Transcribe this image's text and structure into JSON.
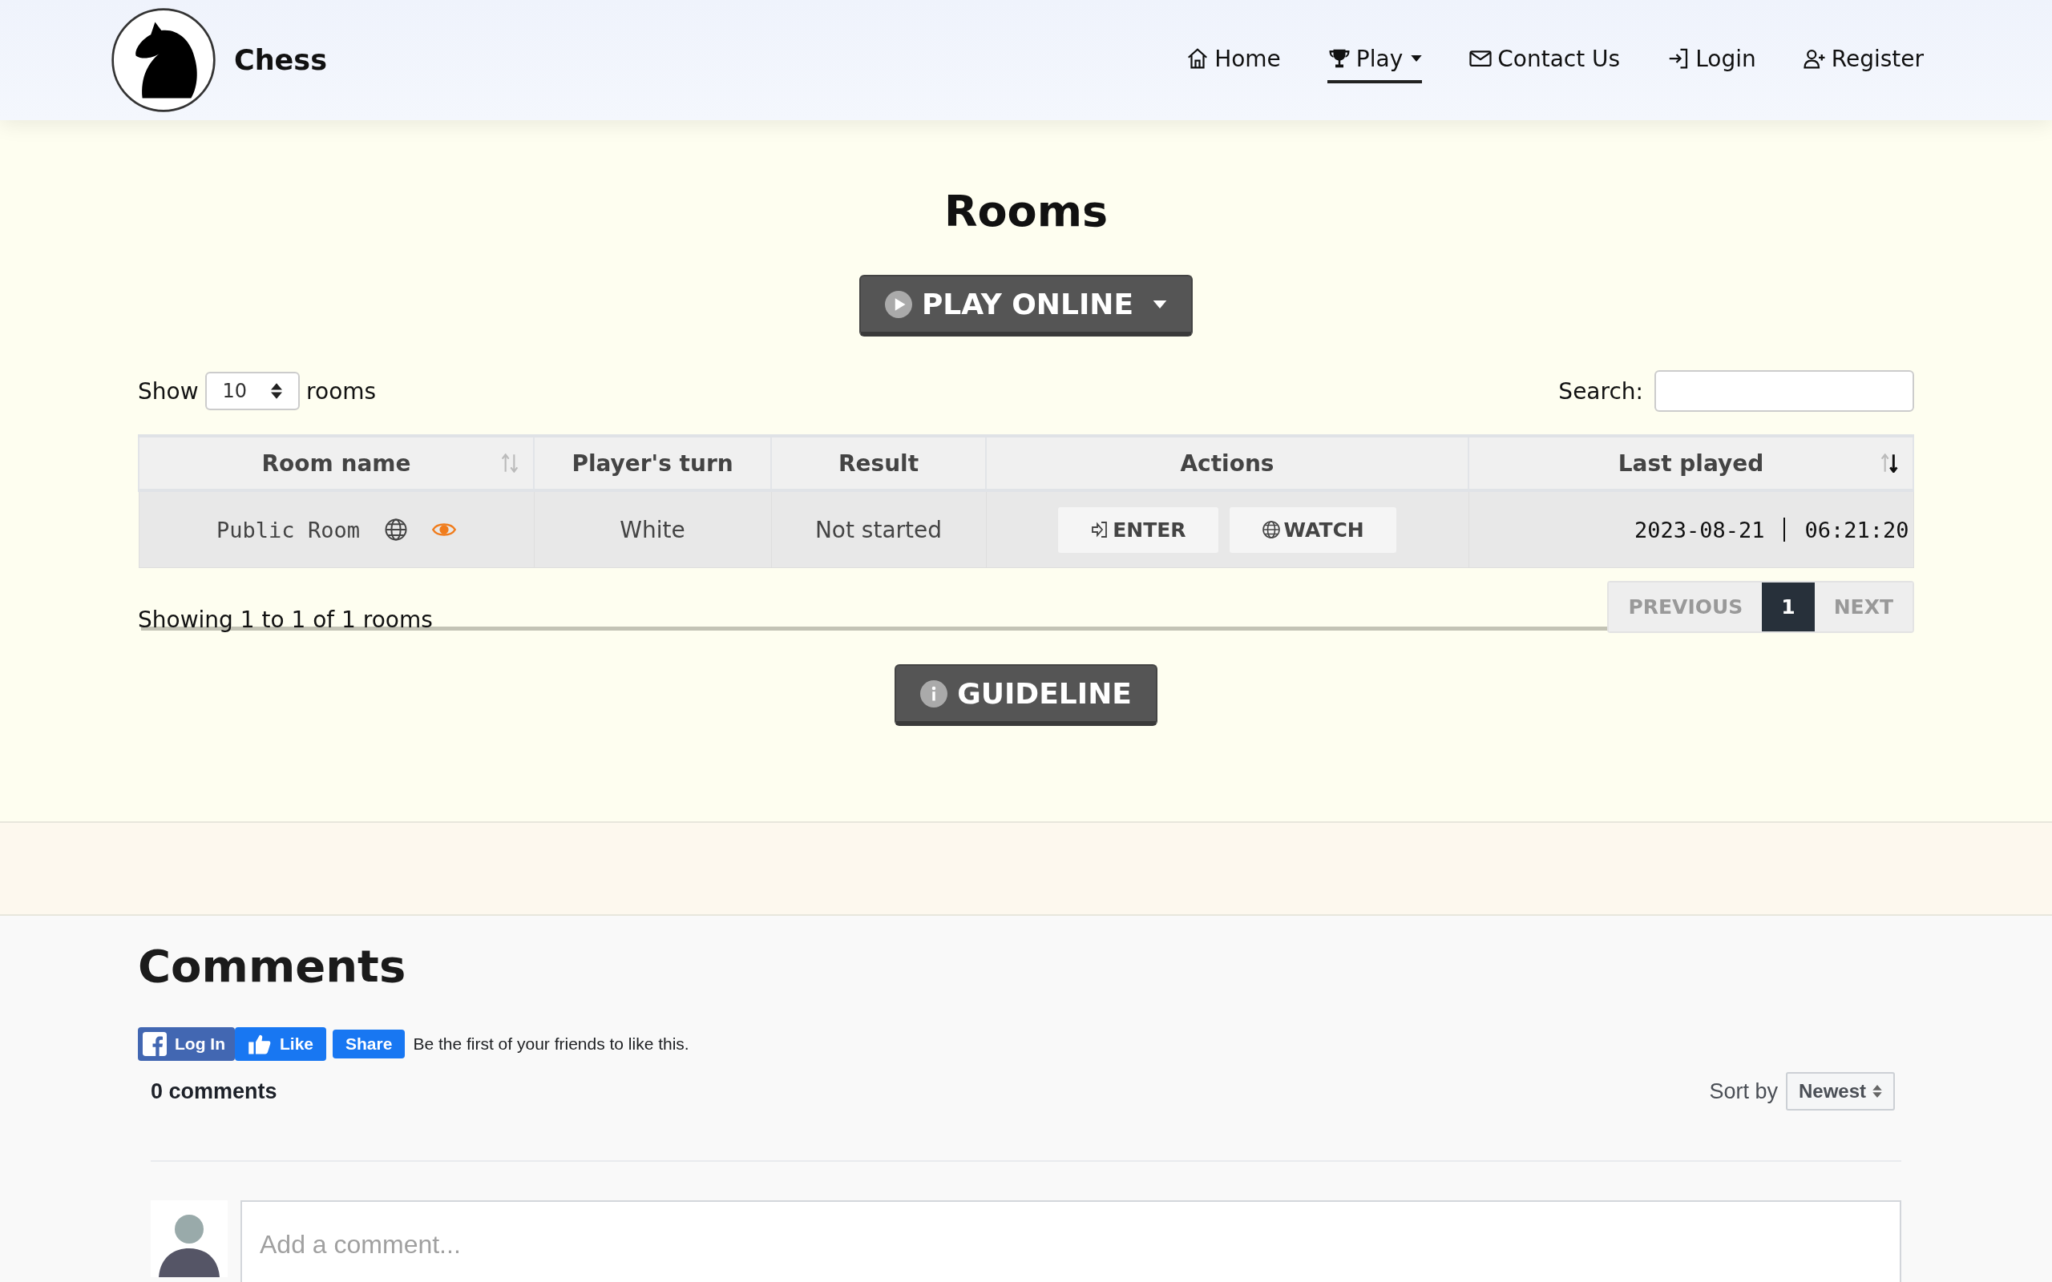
{
  "brand": {
    "name": "Chess"
  },
  "nav": [
    {
      "kind": "home",
      "label": "Home",
      "selected": false,
      "dropdown": false
    },
    {
      "kind": "trophy",
      "label": "Play",
      "selected": true,
      "dropdown": true
    },
    {
      "kind": "mail",
      "label": "Contact Us",
      "selected": false,
      "dropdown": false
    },
    {
      "kind": "login",
      "label": "Login",
      "selected": false,
      "dropdown": false
    },
    {
      "kind": "register",
      "label": "Register",
      "selected": false,
      "dropdown": false
    }
  ],
  "title": "Rooms",
  "play_button": {
    "label": "PLAY ONLINE"
  },
  "length": {
    "before": "Show",
    "value": "10",
    "after": "rooms"
  },
  "search": {
    "label": "Search:"
  },
  "table": {
    "columns": [
      {
        "label": "Room name",
        "sortable": true,
        "sorted_desc": false
      },
      {
        "label": "Player's turn",
        "sortable": false
      },
      {
        "label": "Result",
        "sortable": false
      },
      {
        "label": "Actions",
        "sortable": false
      },
      {
        "label": "Last played",
        "sortable": true,
        "sorted_desc": true
      }
    ],
    "rows": [
      {
        "name": "Public Room",
        "public": true,
        "watchable": true,
        "turn": "White",
        "result": "Not started",
        "actions": [
          {
            "kind": "enter",
            "label": "ENTER"
          },
          {
            "kind": "watch",
            "label": "WATCH"
          }
        ],
        "date": "2023-08-21",
        "time": "06:21:20"
      }
    ]
  },
  "info": "Showing 1 to 1 of 1 rooms",
  "pagination": [
    {
      "label": "PREVIOUS",
      "selected": false,
      "disabled": true
    },
    {
      "label": "1",
      "selected": true,
      "disabled": false
    },
    {
      "label": "NEXT",
      "selected": false,
      "disabled": true
    }
  ],
  "guideline_button": {
    "label": "GUIDELINE"
  },
  "comments": {
    "heading": "Comments",
    "social": [
      {
        "kind": "login",
        "label": "Log In"
      },
      {
        "kind": "like",
        "label": "Like"
      },
      {
        "kind": "share",
        "label": "Share"
      }
    ],
    "social_text": "Be the first of your friends to like this.",
    "count": "0 comments",
    "sort_label": "Sort by",
    "sort_value": "Newest",
    "placeholder": "Add a comment..."
  }
}
